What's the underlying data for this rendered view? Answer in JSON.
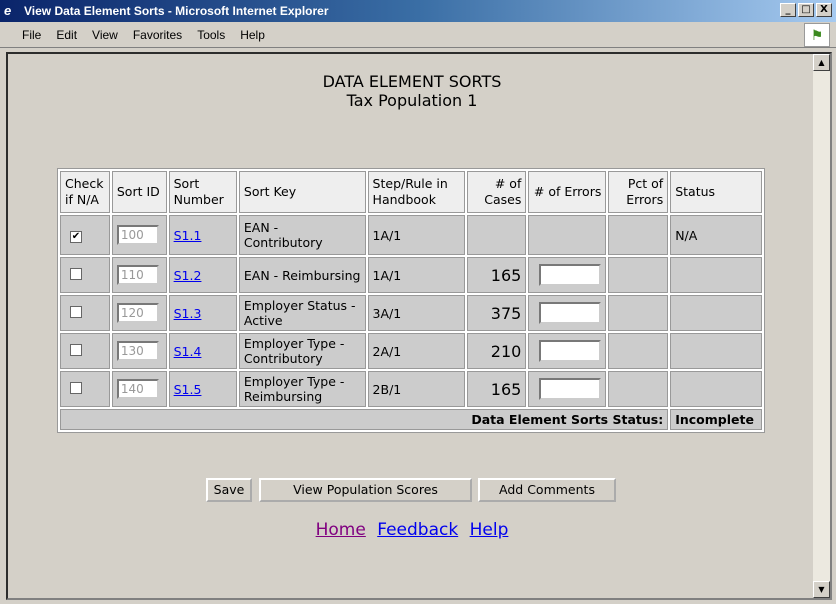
{
  "window": {
    "title": "View Data Element Sorts - Microsoft Internet Explorer",
    "minimize": "_",
    "maximize": "□",
    "close": "X"
  },
  "menu": [
    "File",
    "Edit",
    "View",
    "Favorites",
    "Tools",
    "Help"
  ],
  "page": {
    "title": "DATA ELEMENT SORTS",
    "subtitle": "Tax Population 1"
  },
  "table": {
    "headers": [
      "Check if N/A",
      "Sort ID",
      "Sort Number",
      "Sort Key",
      "Step/Rule in Handbook",
      "# of Cases",
      "# of Errors",
      "Pct of Errors",
      "Status"
    ],
    "rows": [
      {
        "checked": true,
        "sort_id": "100",
        "sort_number": "S1.1",
        "sort_key": "EAN - Contributory",
        "step": "1A/1",
        "cases": "",
        "errors_input": false,
        "pct": "",
        "status": "N/A"
      },
      {
        "checked": false,
        "sort_id": "110",
        "sort_number": "S1.2",
        "sort_key": "EAN - Reimbursing",
        "step": "1A/1",
        "cases": "165",
        "errors_input": true,
        "pct": "",
        "status": ""
      },
      {
        "checked": false,
        "sort_id": "120",
        "sort_number": "S1.3",
        "sort_key": "Employer Status - Active",
        "step": "3A/1",
        "cases": "375",
        "errors_input": true,
        "pct": "",
        "status": ""
      },
      {
        "checked": false,
        "sort_id": "130",
        "sort_number": "S1.4",
        "sort_key": "Employer Type - Contributory",
        "step": "2A/1",
        "cases": "210",
        "errors_input": true,
        "pct": "",
        "status": ""
      },
      {
        "checked": false,
        "sort_id": "140",
        "sort_number": "S1.5",
        "sort_key": "Employer Type - Reimbursing",
        "step": "2B/1",
        "cases": "165",
        "errors_input": true,
        "pct": "",
        "status": ""
      }
    ],
    "status_label": "Data Element Sorts Status:",
    "status_value": "Incomplete"
  },
  "buttons": {
    "save": "Save",
    "view_scores": "View Population Scores",
    "add_comments": "Add Comments"
  },
  "links": {
    "home": "Home",
    "feedback": "Feedback",
    "help": "Help"
  }
}
